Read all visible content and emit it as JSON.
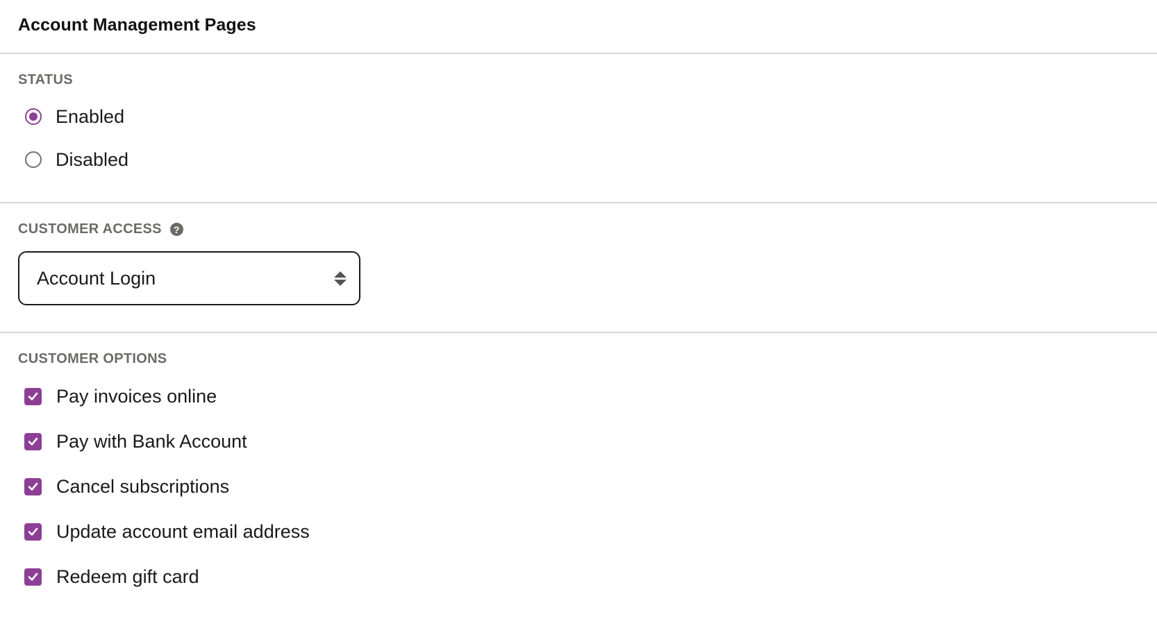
{
  "header": {
    "title": "Account Management Pages"
  },
  "status": {
    "label": "STATUS",
    "options": [
      {
        "label": "Enabled",
        "checked": true
      },
      {
        "label": "Disabled",
        "checked": false
      }
    ]
  },
  "customer_access": {
    "label": "CUSTOMER ACCESS",
    "help_icon": "question-circle-icon",
    "help_glyph": "?",
    "selected": "Account Login"
  },
  "customer_options": {
    "label": "CUSTOMER OPTIONS",
    "items": [
      {
        "label": "Pay invoices online",
        "checked": true
      },
      {
        "label": "Pay with Bank Account",
        "checked": true
      },
      {
        "label": "Cancel subscriptions",
        "checked": true
      },
      {
        "label": "Update account email address",
        "checked": true
      },
      {
        "label": "Redeem gift card",
        "checked": true
      }
    ]
  },
  "colors": {
    "accent": "#8c3f95",
    "label_gray": "#6b6b66",
    "divider": "#d6d6d6"
  }
}
